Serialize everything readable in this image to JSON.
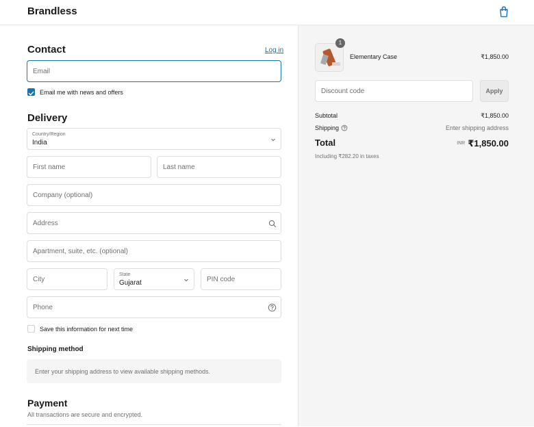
{
  "header": {
    "brand": "Brandless",
    "cart_icon": "shopping-bag-icon"
  },
  "contact": {
    "title": "Contact",
    "login_link": "Log in",
    "email_placeholder": "Email",
    "newsletter_label": "Email me with news and offers",
    "newsletter_checked": true
  },
  "delivery": {
    "title": "Delivery",
    "country_label": "Country/Region",
    "country_value": "India",
    "first_name_placeholder": "First name",
    "last_name_placeholder": "Last name",
    "company_placeholder": "Company (optional)",
    "address_placeholder": "Address",
    "apartment_placeholder": "Apartment, suite, etc. (optional)",
    "city_placeholder": "City",
    "state_label": "State",
    "state_value": "Gujarat",
    "pin_placeholder": "PIN code",
    "phone_placeholder": "Phone",
    "save_info_label": "Save this information for next time",
    "save_info_checked": false
  },
  "shipping_method": {
    "title": "Shipping method",
    "note": "Enter your shipping address to view available shipping methods."
  },
  "payment": {
    "title": "Payment",
    "subtitle": "All transactions are secure and encrypted."
  },
  "summary": {
    "item": {
      "name": "Elementary Case",
      "price": "₹1,850.00",
      "quantity": "1"
    },
    "discount_placeholder": "Discount code",
    "apply_label": "Apply",
    "subtotal_label": "Subtotal",
    "subtotal_value": "₹1,850.00",
    "shipping_label": "Shipping",
    "shipping_value": "Enter shipping address",
    "total_label": "Total",
    "total_currency": "INR",
    "total_value": "₹1,850.00",
    "taxes_note": "Including ₹282.20 in taxes"
  },
  "colors": {
    "accent": "#1773b0",
    "panel_bg": "#f5f5f5",
    "border": "#dedede"
  }
}
